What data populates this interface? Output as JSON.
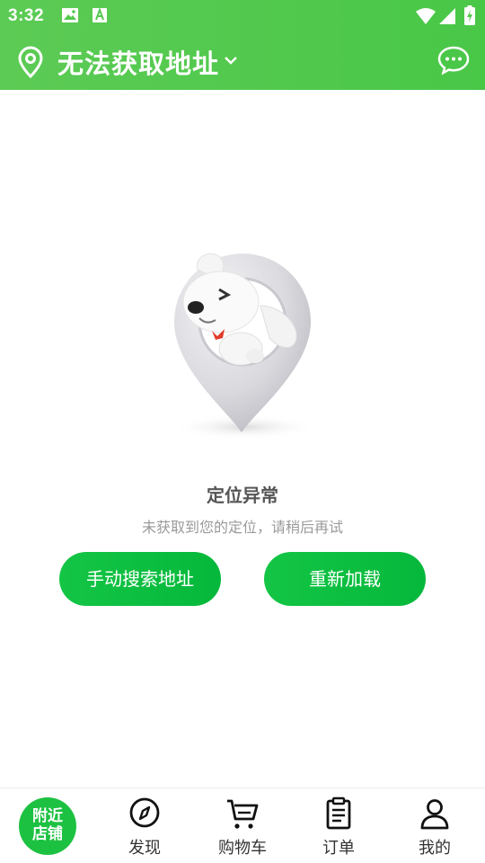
{
  "status_bar": {
    "time": "3:32"
  },
  "header": {
    "address": "无法获取地址"
  },
  "error": {
    "title": "定位异常",
    "subtitle": "未获取到您的定位，请稍后再试"
  },
  "buttons": {
    "manual_search": "手动搜索地址",
    "reload": "重新加载"
  },
  "tabbar": {
    "nearby_line1": "附近",
    "nearby_line2": "店铺",
    "items": [
      {
        "label": "发现",
        "icon": "compass-icon"
      },
      {
        "label": "购物车",
        "icon": "cart-icon"
      },
      {
        "label": "订单",
        "icon": "clipboard-icon"
      },
      {
        "label": "我的",
        "icon": "user-icon"
      }
    ]
  },
  "colors": {
    "header_green": "#52c94e",
    "button_green": "#0abd3f",
    "tab_text": "#333333"
  }
}
